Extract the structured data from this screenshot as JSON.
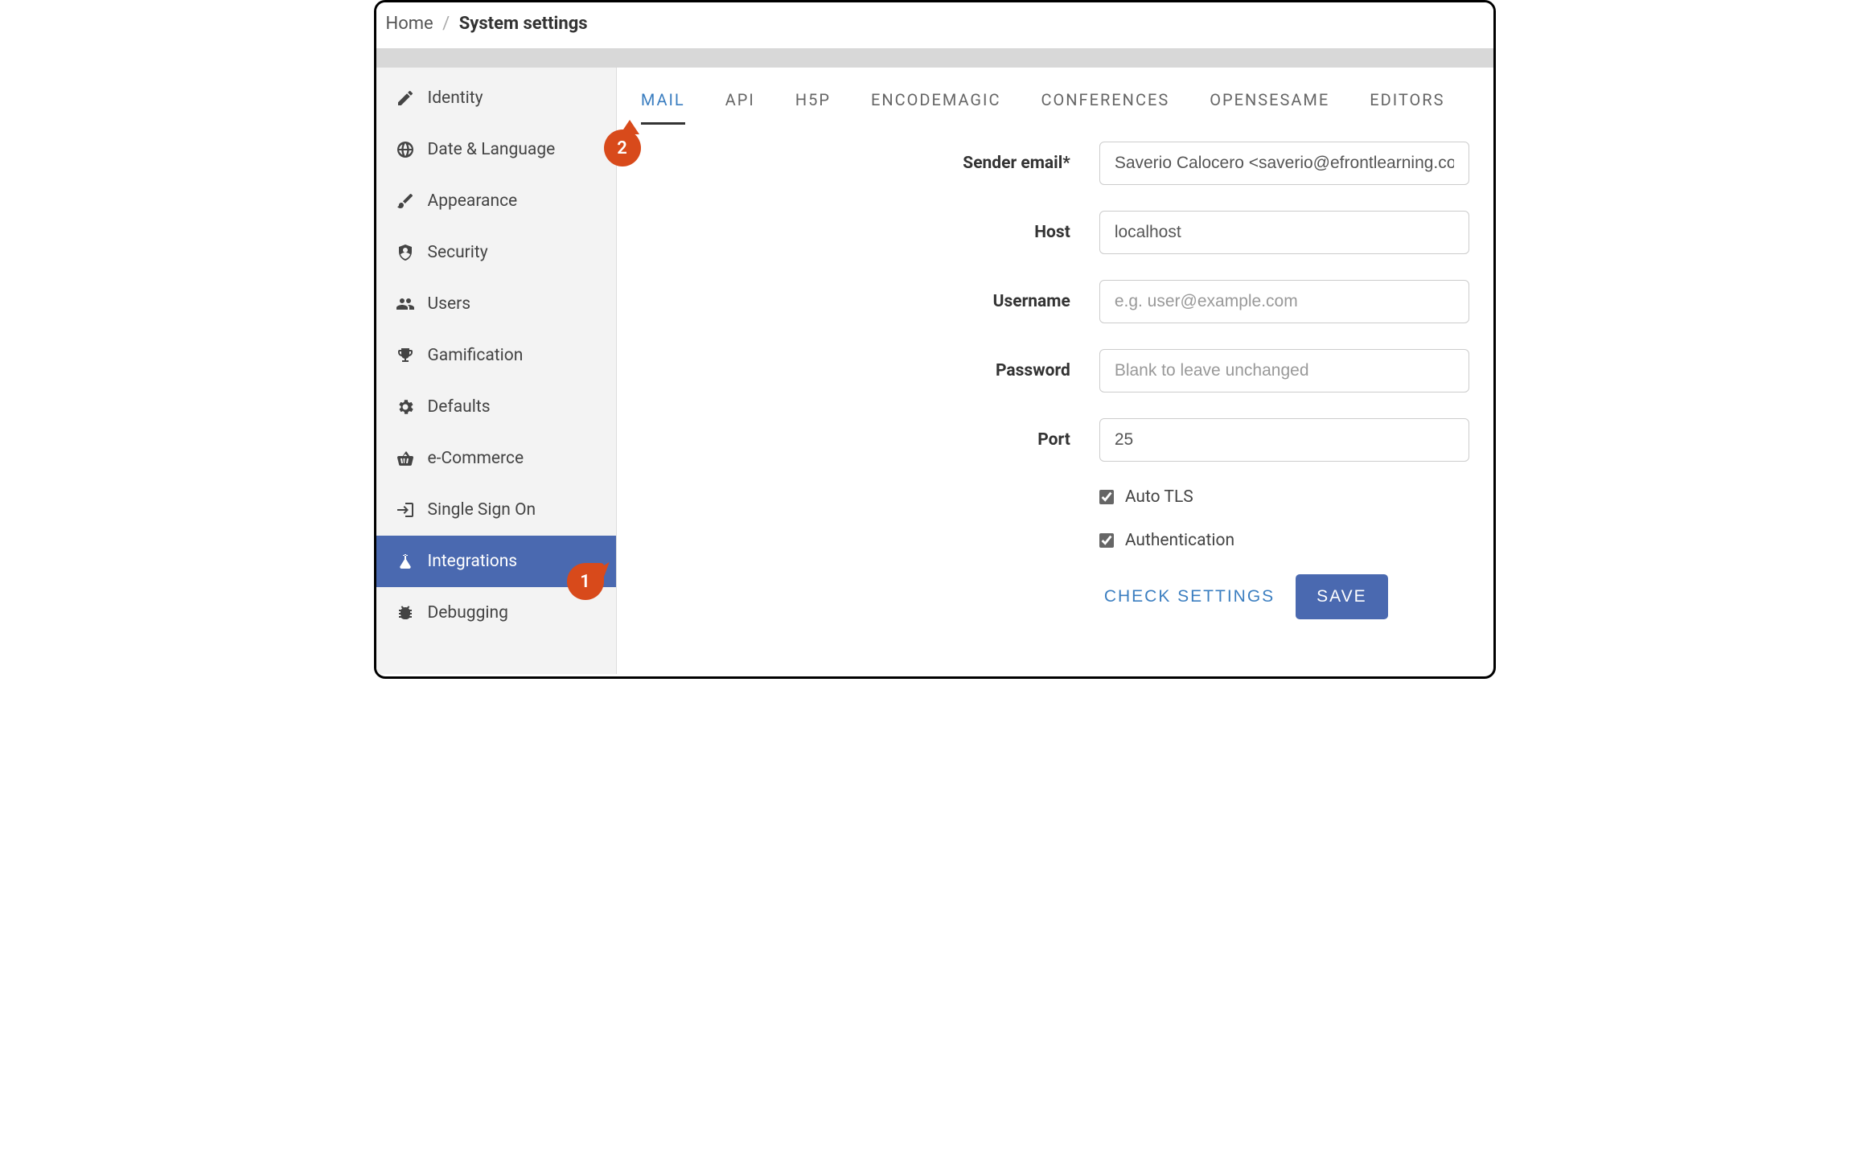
{
  "breadcrumb": {
    "home": "Home",
    "current": "System settings"
  },
  "sidebar": {
    "items": [
      {
        "label": "Identity"
      },
      {
        "label": "Date & Language"
      },
      {
        "label": "Appearance"
      },
      {
        "label": "Security"
      },
      {
        "label": "Users"
      },
      {
        "label": "Gamification"
      },
      {
        "label": "Defaults"
      },
      {
        "label": "e-Commerce"
      },
      {
        "label": "Single Sign On"
      },
      {
        "label": "Integrations"
      },
      {
        "label": "Debugging"
      }
    ]
  },
  "tabs": {
    "items": [
      {
        "label": "MAIL"
      },
      {
        "label": "API"
      },
      {
        "label": "H5P"
      },
      {
        "label": "ENCODEMAGIC"
      },
      {
        "label": "CONFERENCES"
      },
      {
        "label": "OPENSESAME"
      },
      {
        "label": "EDITORS"
      }
    ]
  },
  "form": {
    "sender_label": "Sender email*",
    "sender_value": "Saverio Calocero <saverio@efrontlearning.com>",
    "host_label": "Host",
    "host_value": "localhost",
    "username_label": "Username",
    "username_value": "",
    "username_placeholder": "e.g. user@example.com",
    "password_label": "Password",
    "password_value": "",
    "password_placeholder": "Blank to leave unchanged",
    "port_label": "Port",
    "port_value": "25",
    "autotls_label": "Auto TLS",
    "auth_label": "Authentication",
    "check_label": "CHECK SETTINGS",
    "save_label": "SAVE"
  },
  "annotations": {
    "one": "1",
    "two": "2"
  }
}
